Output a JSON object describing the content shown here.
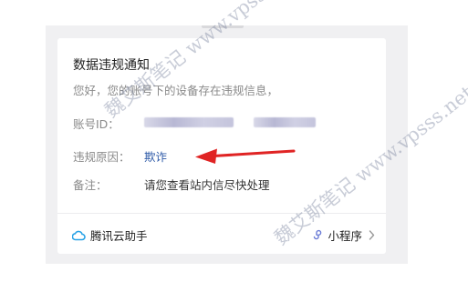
{
  "notice": {
    "title": "数据违规通知",
    "greeting": "您好，您的账号下的设备存在违规信息，",
    "fields": [
      {
        "label": "账号ID：",
        "value": ""
      },
      {
        "label": "违规原因：",
        "value": "欺诈"
      },
      {
        "label": "备注：",
        "value": "请您查看站内信尽快处理"
      }
    ]
  },
  "footer": {
    "app_name": "腾讯云助手",
    "app_icon": "cloud-icon",
    "mini_program_label": "小程序",
    "mini_program_icon": "mini-program-icon",
    "chevron_icon": "chevron-right-icon"
  },
  "watermarks": [
    "魏艾斯笔记 www.vpsss.net",
    "魏艾斯笔记 www.vpsss.net"
  ],
  "colors": {
    "link": "#2f5ba8",
    "arrow": "#e02424",
    "cloud_icon": "#2aa3e6",
    "mini_program_icon": "#6a7bd6"
  }
}
